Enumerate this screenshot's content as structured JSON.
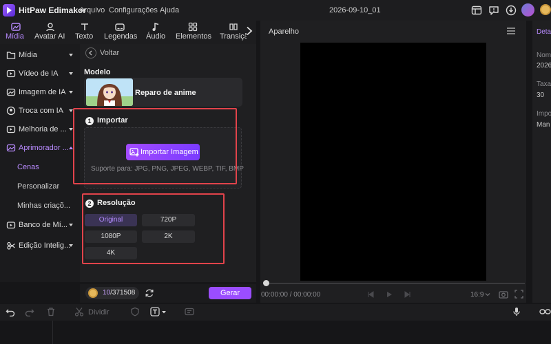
{
  "titlebar": {
    "app_title": "HitPaw Edimakor",
    "menus": [
      "Arquivo",
      "Configurações",
      "Ajuda"
    ],
    "project_name": "2026-09-10_01"
  },
  "toolbar": {
    "tabs": [
      {
        "label": "Mídia",
        "icon": "media-icon",
        "active": true
      },
      {
        "label": "Avatar AI",
        "icon": "avatar-ai-icon"
      },
      {
        "label": "Texto",
        "icon": "text-icon"
      },
      {
        "label": "Legendas",
        "icon": "captions-icon"
      },
      {
        "label": "Áudio",
        "icon": "audio-icon"
      },
      {
        "label": "Elementos",
        "icon": "elements-icon"
      },
      {
        "label": "Transiçã",
        "icon": "transition-icon"
      }
    ]
  },
  "sidebar": {
    "items": [
      {
        "label": "Mídia",
        "icon": "media-folder-icon"
      },
      {
        "label": "Vídeo de IA",
        "icon": "ai-video-icon"
      },
      {
        "label": "Imagem de IA",
        "icon": "ai-image-icon"
      },
      {
        "label": "Troca com IA",
        "icon": "face-swap-icon"
      },
      {
        "label": "Melhoria de ...",
        "icon": "enhance-icon"
      },
      {
        "label": "Aprimorador ...",
        "icon": "enhancer-icon",
        "active": true
      },
      {
        "label": "Banco de Mí...",
        "icon": "media-bank-icon"
      },
      {
        "label": "Edição Intelig...",
        "icon": "smart-edit-icon"
      }
    ],
    "subitems": [
      {
        "label": "Cenas",
        "active": true
      },
      {
        "label": "Personalizar"
      },
      {
        "label": "Minhas criaçõ..."
      }
    ]
  },
  "panel": {
    "back_label": "Voltar",
    "model_heading": "Modelo",
    "model_name": "Reparo de anime",
    "import_heading": "Importar",
    "import_number": "1",
    "import_button": "Importar Imagem",
    "support_text": "Suporte para: JPG, PNG, JPEG, WEBP, TIF, BMP",
    "resolution_heading": "Resolução",
    "resolution_number": "2",
    "resolution_options": [
      {
        "label": "Original",
        "selected": true
      },
      {
        "label": "720P"
      },
      {
        "label": "1080P"
      },
      {
        "label": "2K"
      },
      {
        "label": "4K"
      }
    ],
    "credits_used": "10",
    "credits_total": "/371508",
    "generate_button": "Gerar"
  },
  "player": {
    "title": "Aparelho",
    "time": "00:00:00 / 00:00:00",
    "ratio": "16:9",
    "progress": 0
  },
  "right_panel": {
    "tab_label": "Deta",
    "rows": [
      "Nom",
      "2026",
      "Taxa",
      "30",
      "Impo",
      "Man"
    ]
  },
  "timeline": {
    "split_label": "Dividir"
  },
  "colors": {
    "accent": "#9b4dff",
    "highlight_box": "#e2434b"
  }
}
